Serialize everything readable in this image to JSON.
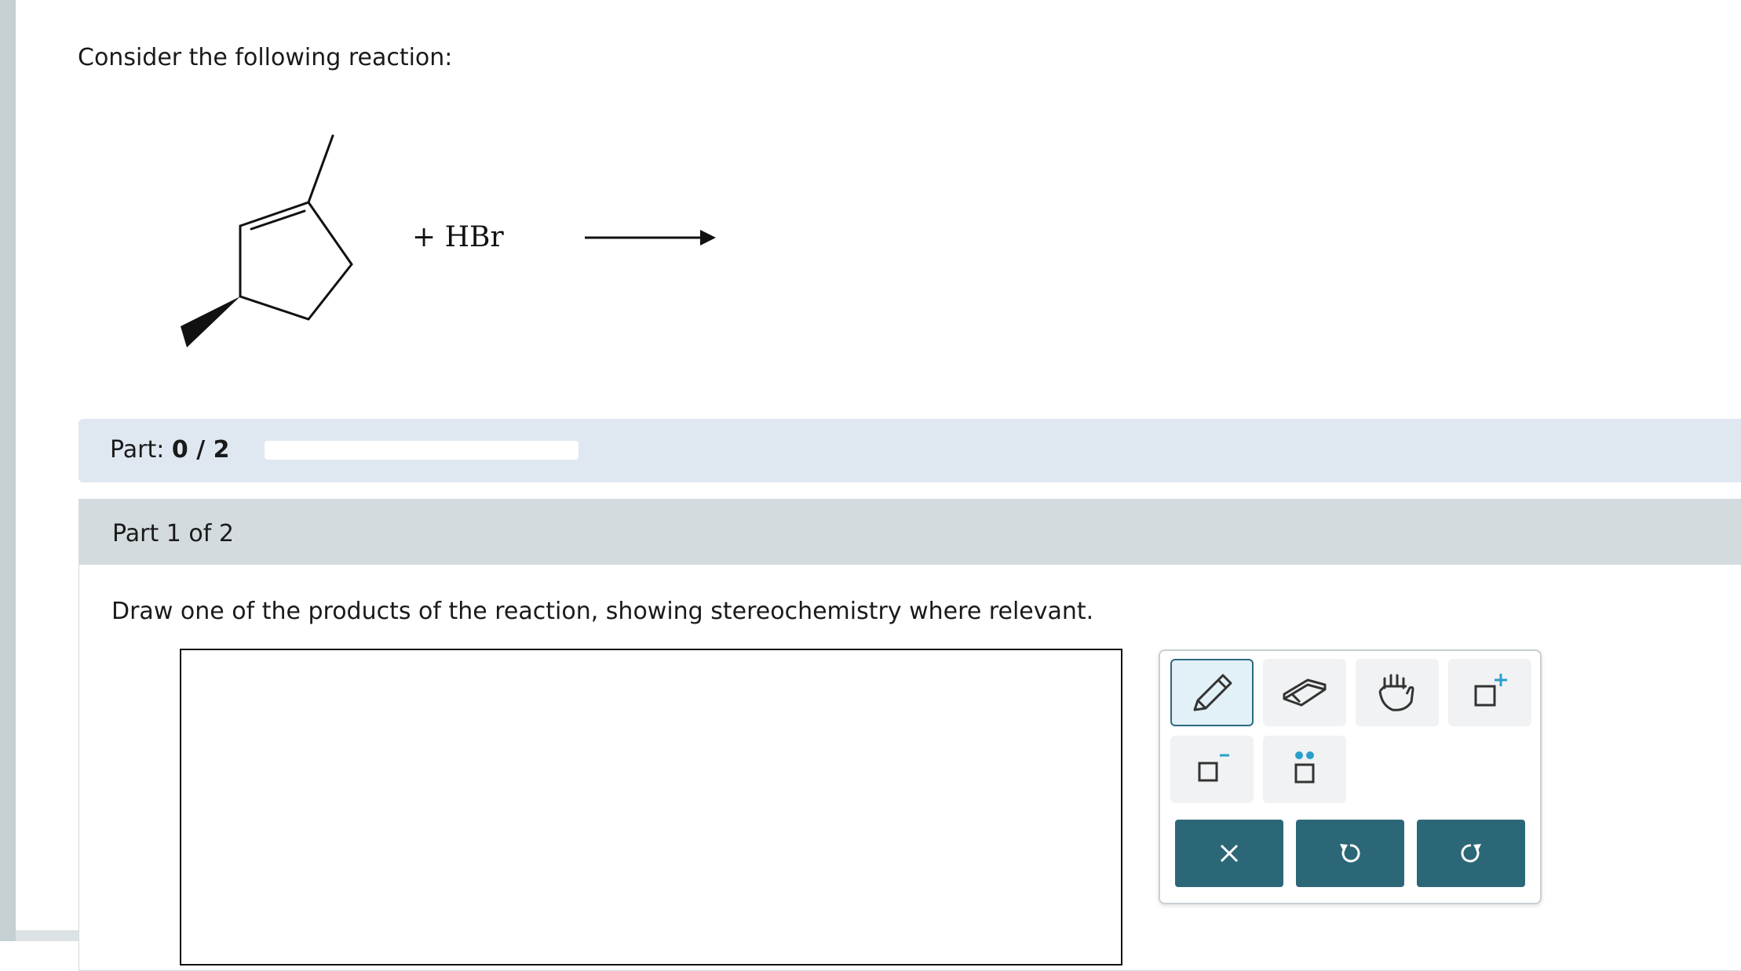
{
  "question": {
    "prompt": "Consider the following reaction:",
    "reagent": "+ HBr"
  },
  "progress": {
    "label": "Part:",
    "value": "0 / 2",
    "fraction": 0
  },
  "part": {
    "heading": "Part 1 of 2",
    "instruction": "Draw one of the products of the reaction, showing stereochemistry where relevant."
  },
  "toolbar": {
    "tools": [
      "pencil-icon",
      "eraser-icon",
      "hand-icon",
      "add-charge-icon",
      "remove-charge-icon",
      "lone-pair-icon"
    ],
    "actions": [
      "clear-icon",
      "undo-icon",
      "redo-icon"
    ]
  },
  "colors": {
    "accent": "#2c6778",
    "part_bar": "#dfe8f1",
    "panel_header": "#d4dbdf",
    "plus_icon": "#2a9fc9"
  }
}
